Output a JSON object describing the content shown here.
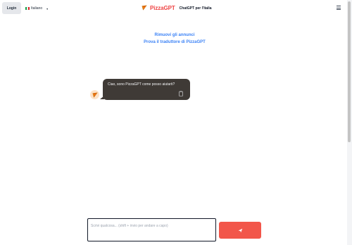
{
  "header": {
    "login_label": "Login",
    "language": {
      "flag_icon": "italy-flag-icon",
      "label": "Italiano"
    },
    "brand": {
      "logo_icon": "pizza-slice-icon",
      "name_prefix": "Pizza",
      "name_suffix": "GPT",
      "tagline": "ChatGPT per l'Italia"
    },
    "menu_icon": "hamburger-menu-icon"
  },
  "links": {
    "remove_ads": "Rimuovi gli annunci",
    "try_translator": "Prova il traduttore di PizzaGPT"
  },
  "chat": {
    "messages": [
      {
        "role": "assistant",
        "avatar_icon": "pizza-slice-icon",
        "text": "Ciao, sono PizzaGPT come posso aiutarti?",
        "action_icon": "clipboard-copy-icon"
      }
    ]
  },
  "composer": {
    "value": "",
    "placeholder": "Scrivi qualcosa... (shift + invio per andare a capo)",
    "send_icon": "paper-plane-icon"
  },
  "colors": {
    "brand_red": "#ef4444",
    "send_button": "#f2564a",
    "link_blue": "#3b82f6",
    "bubble_bg": "#3f3a36"
  }
}
